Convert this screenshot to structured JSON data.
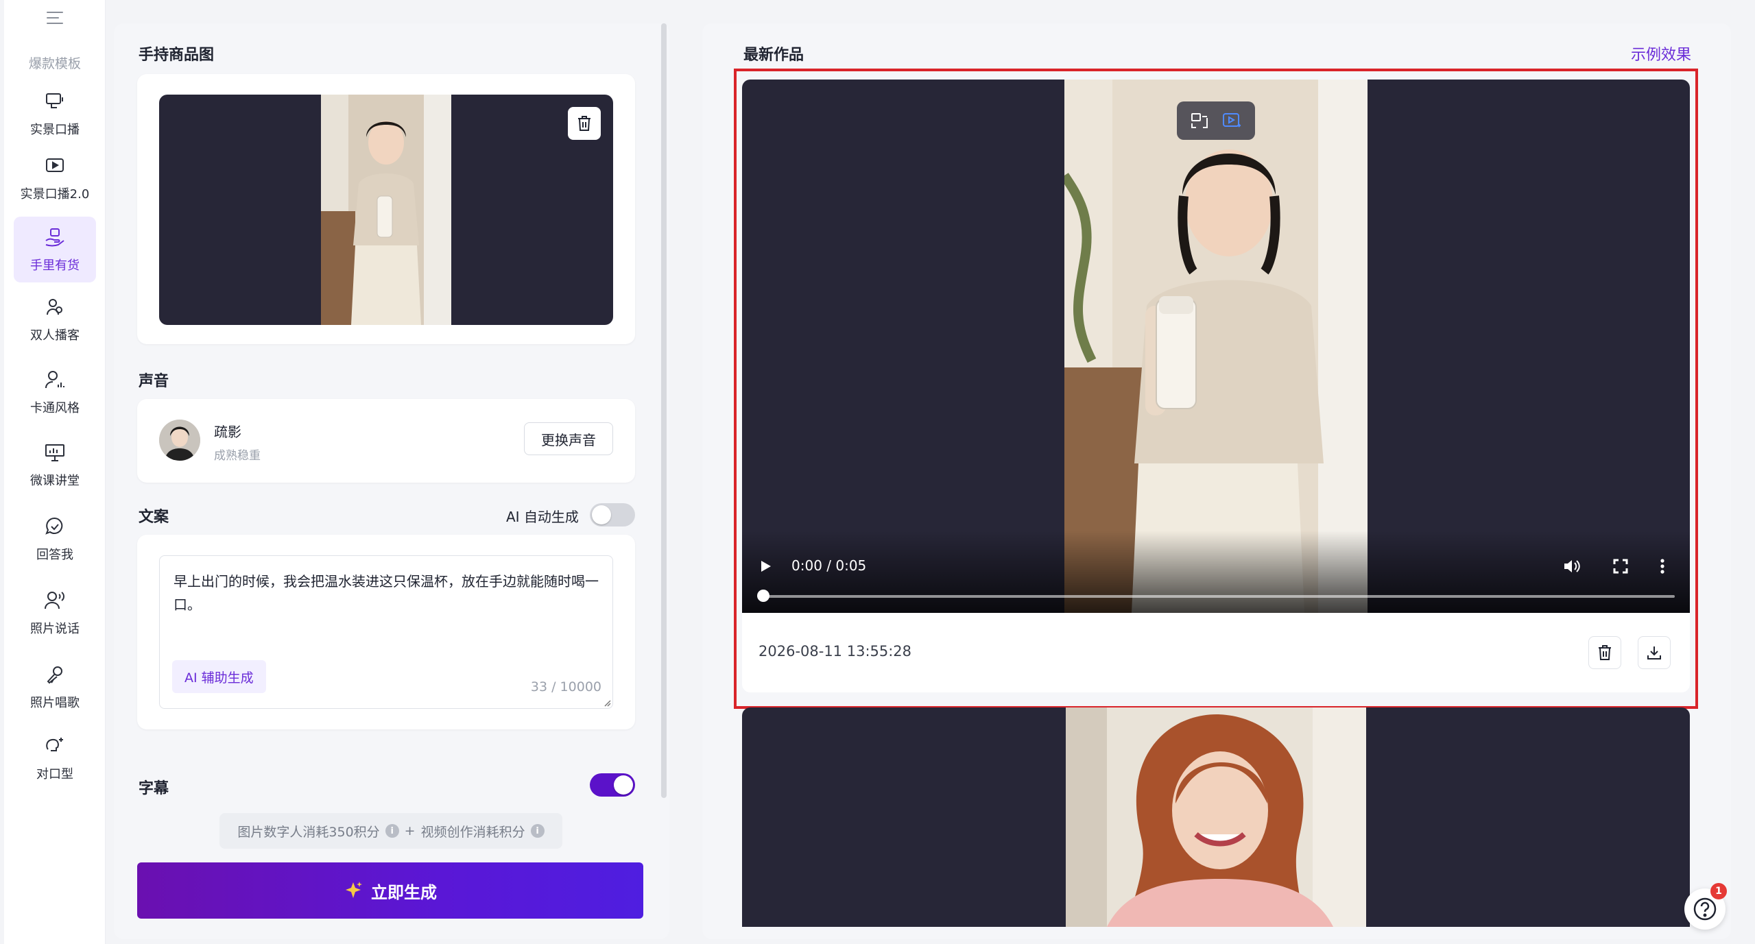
{
  "sidebar": {
    "section_label": "爆款模板",
    "items": [
      {
        "label": "实景口播",
        "icon": "talking-screen-icon",
        "active": false
      },
      {
        "label": "实景口播2.0",
        "icon": "play-screen-icon",
        "active": false
      },
      {
        "label": "手里有货",
        "icon": "hand-product-icon",
        "active": true
      },
      {
        "label": "双人播客",
        "icon": "two-people-icon",
        "active": false
      },
      {
        "label": "卡通风格",
        "icon": "cartoon-person-icon",
        "active": false
      },
      {
        "label": "微课讲堂",
        "icon": "presentation-board-icon",
        "active": false
      },
      {
        "label": "回答我",
        "icon": "chat-check-icon",
        "active": false
      },
      {
        "label": "照片说话",
        "icon": "person-speaking-icon",
        "active": false
      },
      {
        "label": "照片唱歌",
        "icon": "microphone-icon",
        "active": false
      },
      {
        "label": "对口型",
        "icon": "lip-sync-icon",
        "active": false
      }
    ]
  },
  "form": {
    "product_image_title": "手持商品图",
    "voice_title": "声音",
    "voice": {
      "name": "疏影",
      "desc": "成熟稳重",
      "change_label": "更换声音"
    },
    "script_title": "文案",
    "ai_auto_label": "AI 自动生成",
    "ai_auto_on": false,
    "script_text": "早上出门的时候，我会把温水装进这只保温杯，放在手边就能随时喝一口。",
    "ai_assist_label": "AI 辅助生成",
    "char_count": "33 / 10000",
    "subtitle_title": "字幕",
    "subtitle_on": true,
    "cost_part1": "图片数字人消耗350积分",
    "cost_plus": "+",
    "cost_part2": "视频创作消耗积分",
    "generate_label": "立即生成"
  },
  "works": {
    "title": "最新作品",
    "example_link": "示例效果",
    "items": [
      {
        "time_display": "0:00 / 0:05",
        "date": "2026-08-11 13:55:28"
      }
    ]
  },
  "help": {
    "badge": "1"
  },
  "colors": {
    "accent": "#6a2cd8",
    "button_gradient_start": "#6a10b0",
    "button_gradient_end": "#4f1ee0",
    "highlight": "#d9242a",
    "dark_bg": "#272637"
  }
}
